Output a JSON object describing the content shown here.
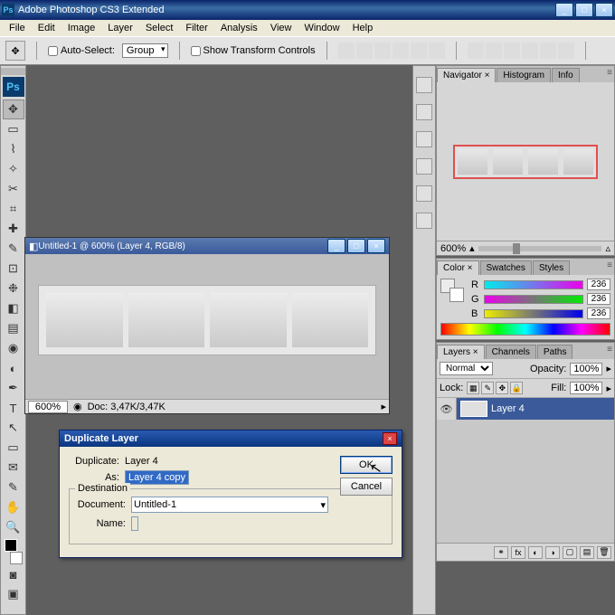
{
  "title": "Adobe Photoshop CS3 Extended",
  "menu": [
    "File",
    "Edit",
    "Image",
    "Layer",
    "Select",
    "Filter",
    "Analysis",
    "View",
    "Window",
    "Help"
  ],
  "options": {
    "auto_select": "Auto-Select:",
    "group": "Group",
    "show_transform": "Show Transform Controls"
  },
  "doc": {
    "title": "Untitled-1 @ 600% (Layer 4, RGB/8)",
    "zoom": "600%",
    "info": "Doc: 3,47K/3,47K"
  },
  "navigator": {
    "tabs": [
      "Navigator ×",
      "Histogram",
      "Info"
    ],
    "zoom": "600%"
  },
  "color": {
    "tabs": [
      "Color ×",
      "Swatches",
      "Styles"
    ],
    "r": "236",
    "g": "236",
    "b": "236",
    "lbl_r": "R",
    "lbl_g": "G",
    "lbl_b": "B"
  },
  "layers": {
    "tabs": [
      "Layers ×",
      "Channels",
      "Paths"
    ],
    "mode": "Normal",
    "opacity_lbl": "Opacity:",
    "opacity": "100%",
    "lock_lbl": "Lock:",
    "fill_lbl": "Fill:",
    "fill": "100%",
    "row": "Layer 4"
  },
  "dialog": {
    "title": "Duplicate Layer",
    "dup_lbl": "Duplicate:",
    "dup_val": "Layer 4",
    "as_lbl": "As:",
    "as_val": "Layer 4 copy",
    "dest_lbl": "Destination",
    "doc_lbl": "Document:",
    "doc_val": "Untitled-1",
    "name_lbl": "Name:",
    "ok": "OK",
    "cancel": "Cancel"
  }
}
